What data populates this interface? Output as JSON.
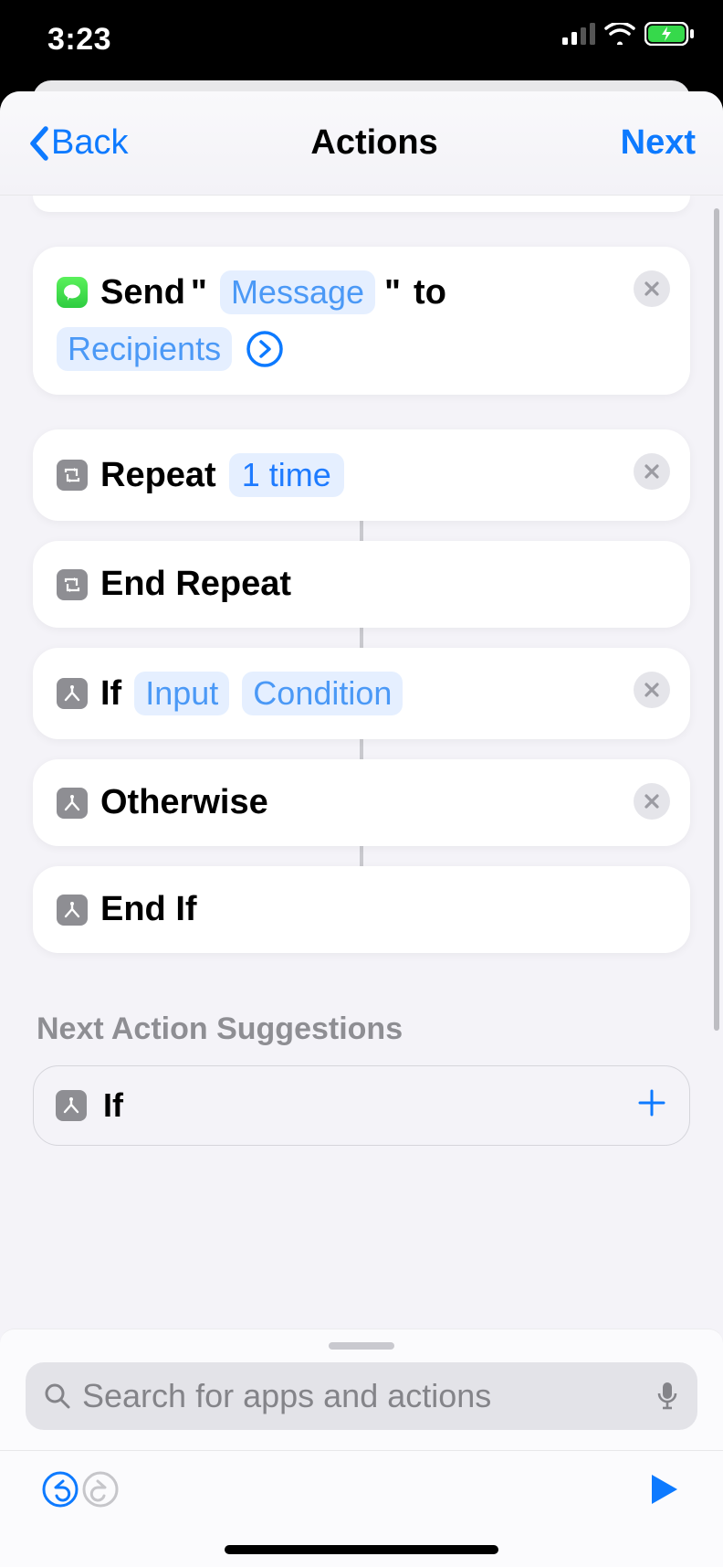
{
  "status": {
    "time": "3:23"
  },
  "nav": {
    "back_label": "Back",
    "title": "Actions",
    "next_label": "Next"
  },
  "actions": {
    "send_message": {
      "verb": "Send",
      "quote_open": "\"",
      "message_token": "Message",
      "quote_close": "\"",
      "to_word": "to",
      "recipients_token": "Recipients"
    },
    "repeat": {
      "label": "Repeat",
      "count_token": "1 time"
    },
    "end_repeat": {
      "label": "End Repeat"
    },
    "if": {
      "label": "If",
      "input_token": "Input",
      "condition_token": "Condition"
    },
    "otherwise": {
      "label": "Otherwise"
    },
    "end_if": {
      "label": "End If"
    }
  },
  "suggestions": {
    "title": "Next Action Suggestions",
    "items": [
      {
        "label": "If"
      }
    ]
  },
  "search": {
    "placeholder": "Search for apps and actions"
  },
  "colors": {
    "accent": "#0d7aff",
    "token_bg": "#e5efff",
    "token_fg": "#4b99f6"
  }
}
